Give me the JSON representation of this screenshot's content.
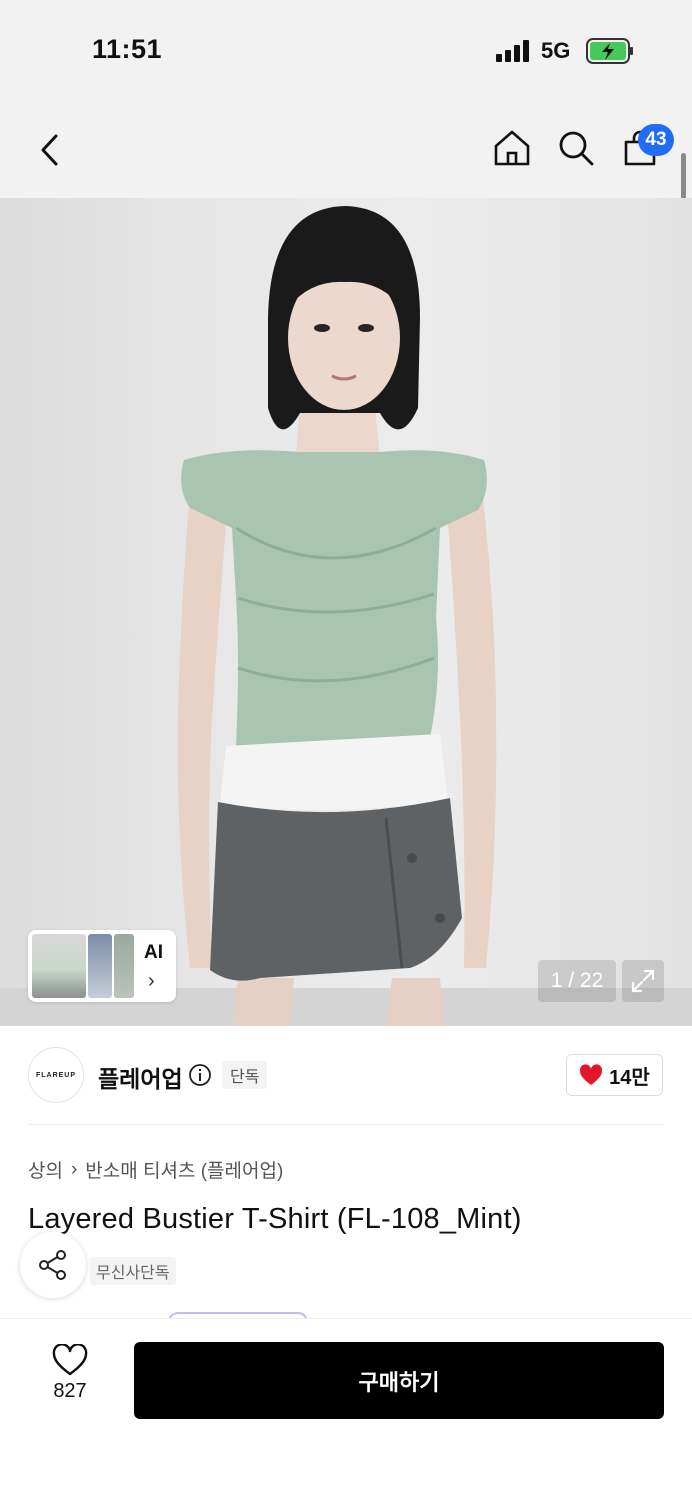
{
  "status_bar": {
    "time": "11:51",
    "network": "5G"
  },
  "header": {
    "cart_count": "43"
  },
  "gallery": {
    "counter": "1 / 22",
    "ai_label": "AI"
  },
  "brand": {
    "logo_text": "FLAREUP",
    "name": "플레어업",
    "tag": "단독",
    "likes": "14만"
  },
  "product": {
    "breadcrumb": [
      "상의",
      "반소매 티셔츠 (플레어업)"
    ],
    "title": "Layered Bustier T-Shirt (FL-108_Mint)",
    "tag": "무신사단독"
  },
  "bottom_bar": {
    "wish_count": "827",
    "buy_label": "구매하기"
  },
  "colors": {
    "accent_blue": "#1f6df5",
    "heart_red": "#e5162b",
    "buy_bg": "#000000"
  },
  "icons": [
    "back-icon",
    "home-icon",
    "search-icon",
    "shopping-bag-icon",
    "expand-icon",
    "info-icon",
    "heart-icon",
    "share-icon",
    "chevron-right-icon"
  ]
}
